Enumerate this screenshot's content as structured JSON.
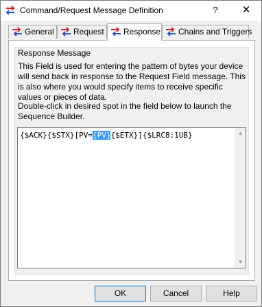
{
  "window": {
    "title": "Command/Request Message Definition",
    "help_glyph": "?",
    "close_glyph": "✕"
  },
  "tabs": [
    {
      "label": "General",
      "icon": "arrows-icon",
      "active": false
    },
    {
      "label": "Request",
      "icon": "arrows-icon",
      "active": false
    },
    {
      "label": "Response",
      "icon": "arrows-icon",
      "active": true
    },
    {
      "label": "Chains and Triggers",
      "icon": "arrows-icon",
      "active": false
    }
  ],
  "response": {
    "group_title": "Response Message",
    "description": "This Field is used for entering the pattern of bytes your device will send back in response to the Request Field message.  This is also where you would specify items to receive specific values or pieces of data.",
    "instruction": "Double-click in desired spot in the field below to launch the Sequence Builder.",
    "field_value": {
      "before_selection": "{$ACK}{$STX}[PV=",
      "selection": "{PV}",
      "after_selection": "{$ETX}]{$LRC8:1UB}"
    }
  },
  "buttons": {
    "ok": "OK",
    "cancel": "Cancel",
    "help": "Help"
  },
  "colors": {
    "selection": "#3399ff",
    "icon_red": "#d9252a",
    "icon_blue": "#2a57c6"
  }
}
